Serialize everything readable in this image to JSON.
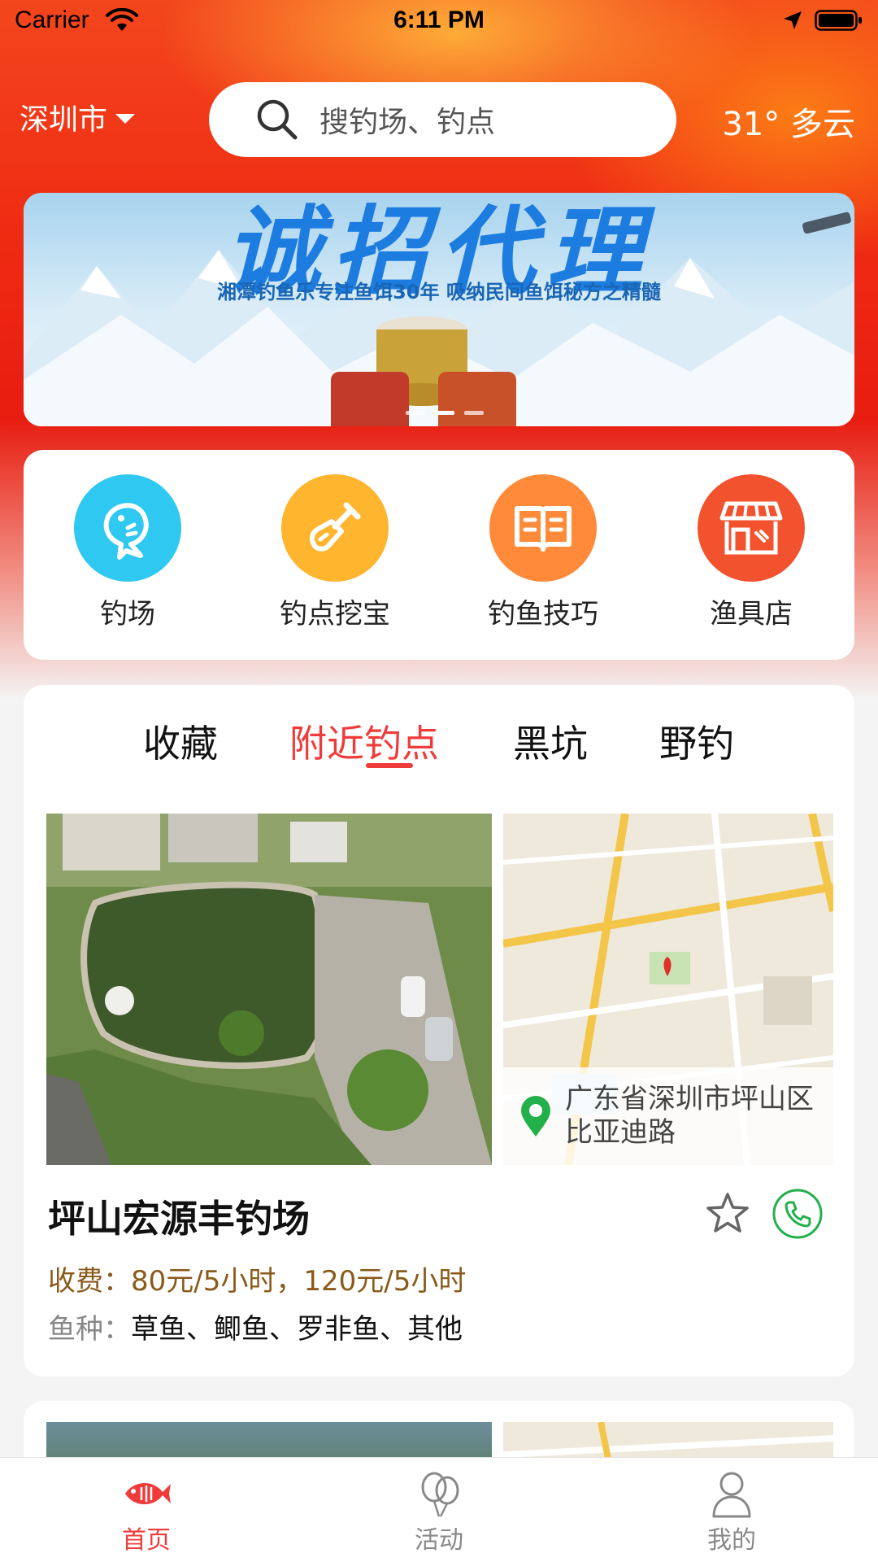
{
  "status_bar": {
    "carrier": "Carrier",
    "time": "6:11 PM"
  },
  "header": {
    "city": "深圳市",
    "search_placeholder": "搜钓场、钓点",
    "weather": "31° 多云"
  },
  "banner": {
    "title": "诚招代理",
    "subtitle": "湘潭钓鱼乐专注鱼饵30年  吸纳民间鱼饵秘方之精髓",
    "active_index": 1,
    "count": 3
  },
  "categories": [
    {
      "label": "钓场",
      "icon": "fish-icon",
      "color": "#2ec8f0"
    },
    {
      "label": "钓点挖宝",
      "icon": "shovel-icon",
      "color": "#ffb52e"
    },
    {
      "label": "钓鱼技巧",
      "icon": "book-icon",
      "color": "#ff8a3a"
    },
    {
      "label": "渔具店",
      "icon": "shop-icon",
      "color": "#f2522e"
    }
  ],
  "tabs": [
    {
      "label": "收藏",
      "active": false
    },
    {
      "label": "附近钓点",
      "active": true
    },
    {
      "label": "黑坑",
      "active": false
    },
    {
      "label": "野钓",
      "active": false
    }
  ],
  "spot": {
    "name": "坪山宏源丰钓场",
    "address": "广东省深圳市坪山区比亚迪路",
    "fee_label": "收费：",
    "fee": "80元/5小时，120元/5小时",
    "fish_label": "鱼种：",
    "fish": "草鱼、鲫鱼、罗非鱼、其他"
  },
  "tabbar": [
    {
      "label": "首页",
      "icon": "fish-home-icon",
      "active": true
    },
    {
      "label": "活动",
      "icon": "balloons-icon",
      "active": false
    },
    {
      "label": "我的",
      "icon": "user-icon",
      "active": false
    }
  ],
  "colors": {
    "accent": "#f03b3b",
    "fee": "#8a5a1a"
  }
}
